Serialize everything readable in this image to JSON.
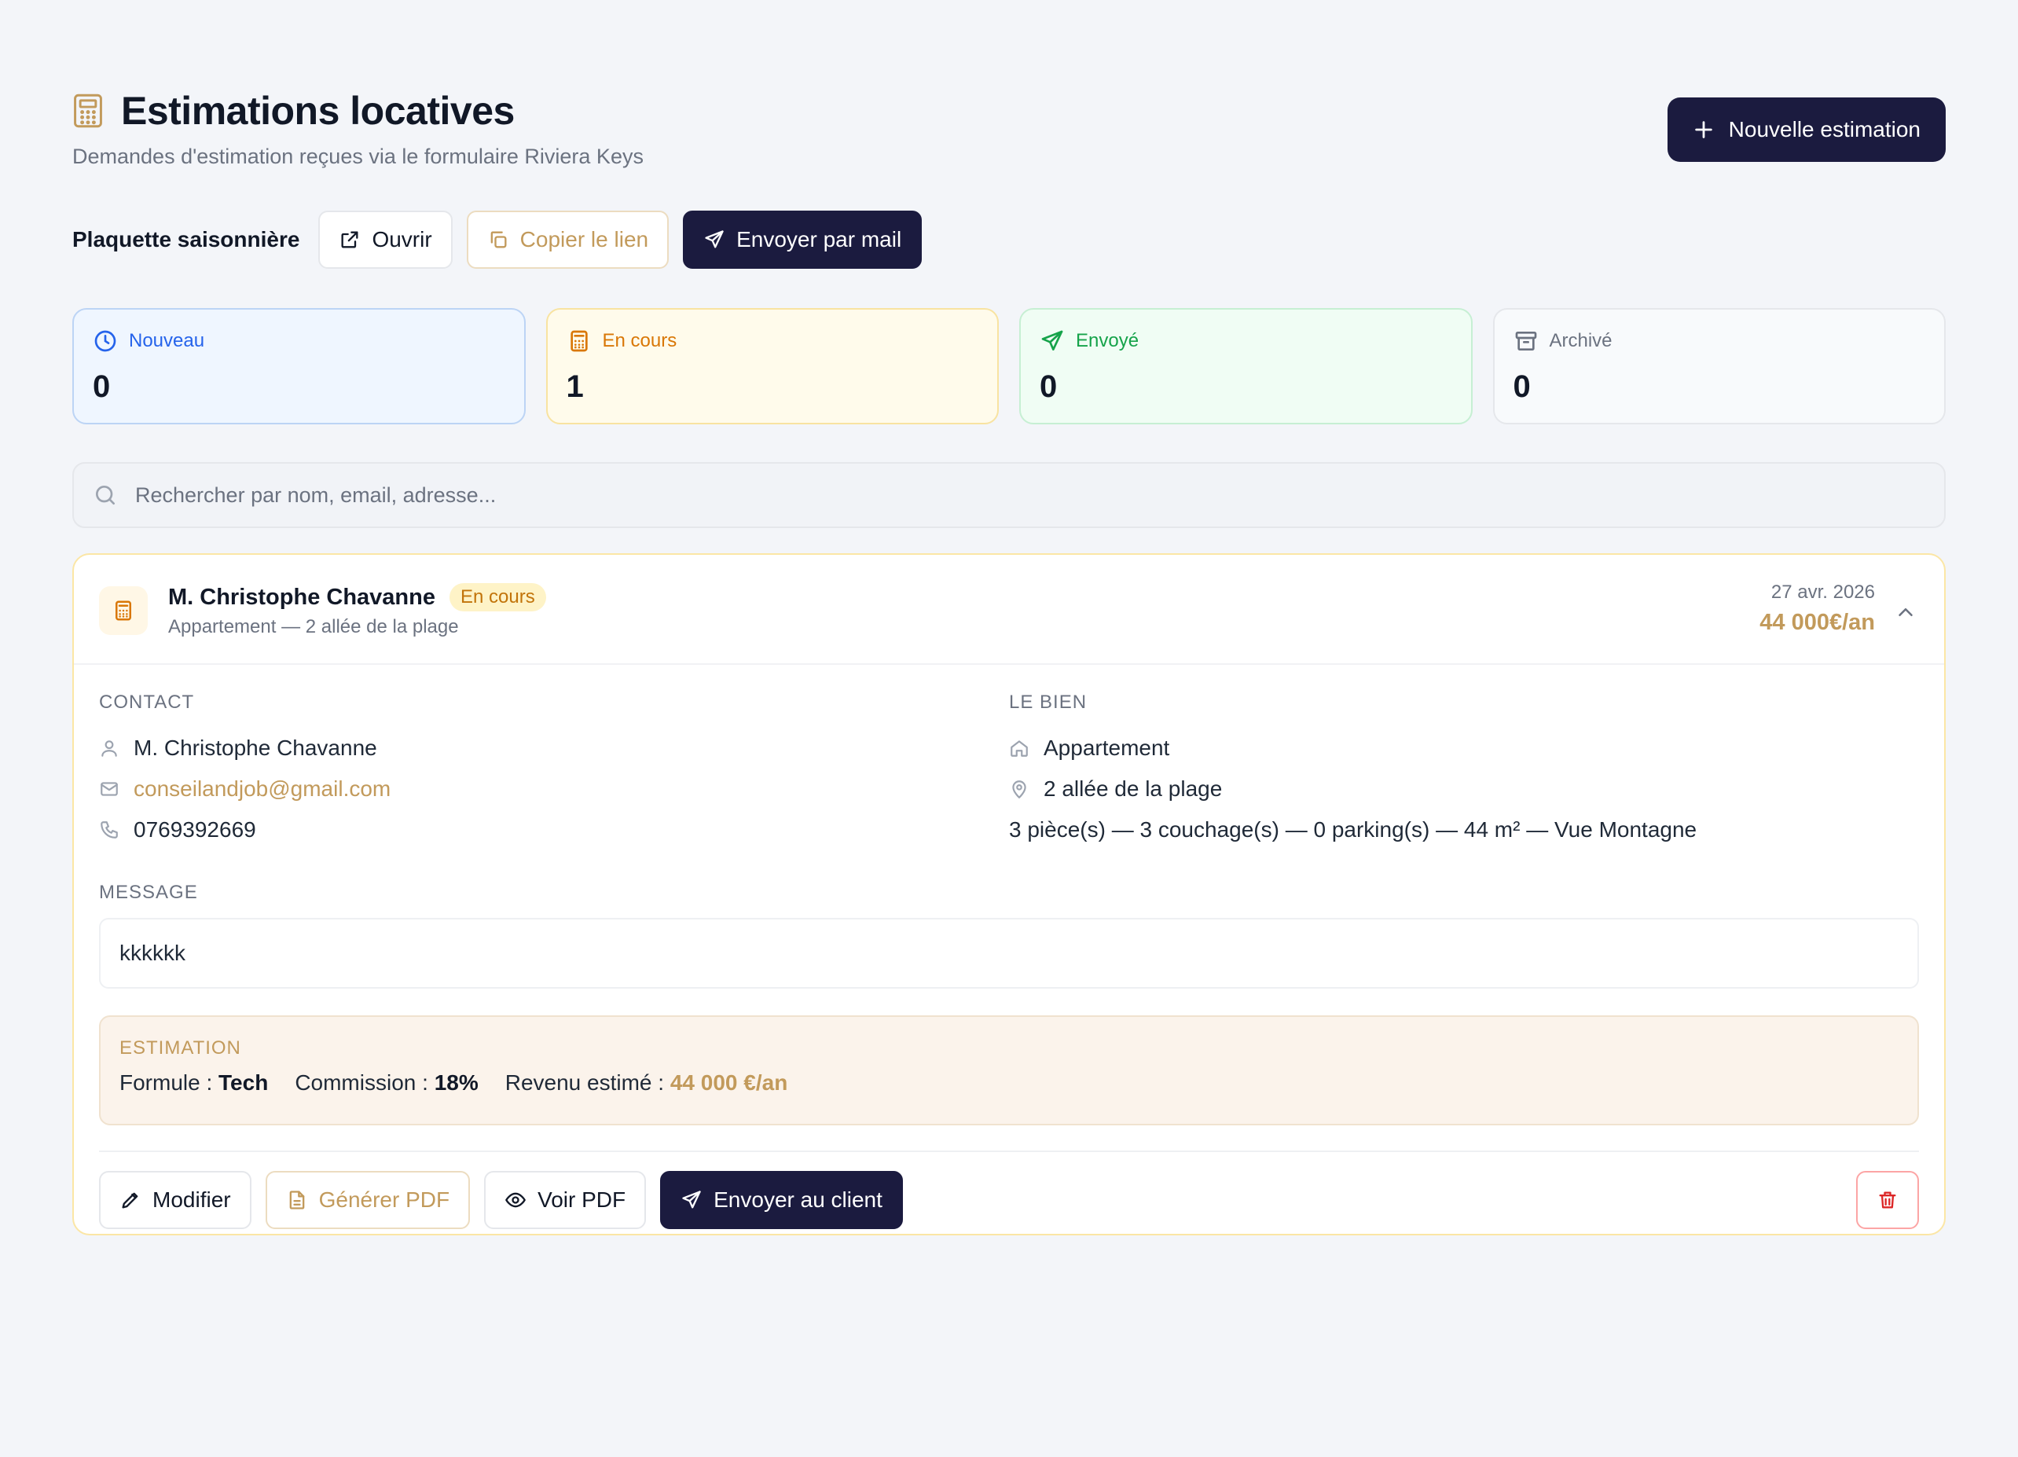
{
  "header": {
    "title": "Estimations locatives",
    "subtitle": "Demandes d'estimation reçues via le formulaire Riviera Keys",
    "new_button": "Nouvelle estimation"
  },
  "plaquette": {
    "label": "Plaquette saisonnière",
    "open": "Ouvrir",
    "copy_link": "Copier le lien",
    "send_mail": "Envoyer par mail"
  },
  "status": [
    {
      "label": "Nouveau",
      "count": "0",
      "icon": "clock-icon",
      "color": "#2563eb"
    },
    {
      "label": "En cours",
      "count": "1",
      "icon": "calculator-icon",
      "color": "#d97706"
    },
    {
      "label": "Envoyé",
      "count": "0",
      "icon": "send-icon",
      "color": "#16a34a"
    },
    {
      "label": "Archivé",
      "count": "0",
      "icon": "archive-icon",
      "color": "#6b7280"
    }
  ],
  "search": {
    "placeholder": "Rechercher par nom, email, adresse..."
  },
  "estimation": {
    "name": "M. Christophe Chavanne",
    "status_badge": "En cours",
    "subtitle": "Appartement — 2 allée de la plage",
    "date": "27 avr. 2026",
    "amount": "44 000€/an",
    "contact_label": "CONTACT",
    "contact_name": "M. Christophe Chavanne",
    "contact_email": "conseilandjob@gmail.com",
    "contact_phone": "0769392669",
    "property_label": "LE BIEN",
    "property_type": "Appartement",
    "property_address": "2 allée de la plage",
    "property_details": "3 pièce(s) — 3 couchage(s) — 0 parking(s) — 44 m² — Vue Montagne",
    "message_label": "MESSAGE",
    "message": "kkkkkk",
    "estimation_label": "ESTIMATION",
    "formula_label": "Formule :",
    "formula_value": "Tech",
    "commission_label": "Commission :",
    "commission_value": "18%",
    "revenue_label": "Revenu estimé :",
    "revenue_value": "44 000 €/an",
    "actions": {
      "edit": "Modifier",
      "generate_pdf": "Générer PDF",
      "view_pdf": "Voir PDF",
      "send_client": "Envoyer au client"
    }
  },
  "colors": {
    "primary": "#1b1b3f",
    "gold": "#c29a5b",
    "danger": "#dc2626"
  }
}
